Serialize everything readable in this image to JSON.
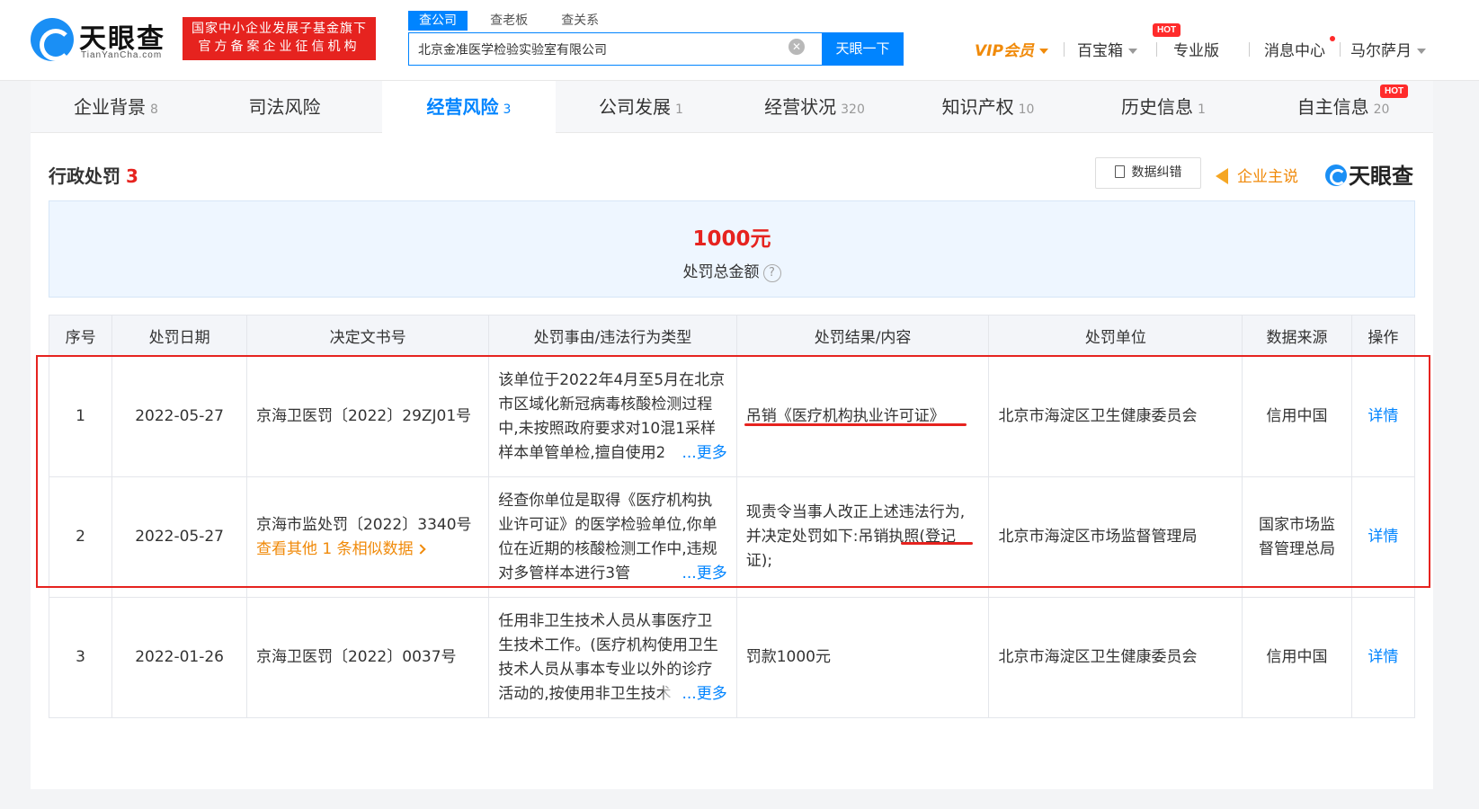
{
  "header": {
    "logo_text": "天眼查",
    "logo_sub": "TianYanCha.com",
    "badge_line1": "国家中小企业发展子基金旗下",
    "badge_line2": "官方备案企业征信机构",
    "search_tabs": [
      "查公司",
      "查老板",
      "查关系"
    ],
    "search_value": "北京金准医学检验实验室有限公司",
    "search_button": "天眼一下",
    "nav": {
      "vip": "VIP会员",
      "toolbox": "百宝箱",
      "toolbox_badge": "HOT",
      "pro": "专业版",
      "messages": "消息中心",
      "user": "马尔萨月"
    }
  },
  "categories": [
    {
      "label": "企业背景",
      "count": "8"
    },
    {
      "label": "司法风险",
      "count": ""
    },
    {
      "label": "经营风险",
      "count": "3"
    },
    {
      "label": "公司发展",
      "count": "1"
    },
    {
      "label": "经营状况",
      "count": "320"
    },
    {
      "label": "知识产权",
      "count": "10"
    },
    {
      "label": "历史信息",
      "count": "1"
    },
    {
      "label": "自主信息",
      "count": "20",
      "badge": "HOT"
    }
  ],
  "section": {
    "title": "行政处罚",
    "count": "3",
    "fix_button": "数据纠错",
    "claim": "企业主说",
    "brand": "天眼查"
  },
  "summary": {
    "amount": "1000元",
    "label": "处罚总金额",
    "help_icon": "question-circle-icon"
  },
  "table": {
    "headers": [
      "序号",
      "处罚日期",
      "决定文书号",
      "处罚事由/违法行为类型",
      "处罚结果/内容",
      "处罚单位",
      "数据来源",
      "操作"
    ],
    "more_label": "...更多",
    "rows": [
      {
        "no": "1",
        "date": "2022-05-27",
        "doc": "京海卫医罚〔2022〕29ZJ01号",
        "doc_extra": "",
        "reason": "该单位于2022年4月至5月在北京市区域化新冠病毒核酸检测过程中,未按照政府要求对10混1采样样本单管单检,擅自使用2",
        "result": "吊销《医疗机构执业许可证》",
        "authority": "北京市海淀区卫生健康委员会",
        "source": "信用中国",
        "action": "详情"
      },
      {
        "no": "2",
        "date": "2022-05-27",
        "doc": "京海市监处罚〔2022〕3340号",
        "doc_extra": "查看其他 1 条相似数据",
        "reason": "经查你单位是取得《医疗机构执业许可证》的医学检验单位,你单位在近期的核酸检测工作中,违规对多管样本进行3管",
        "result": "现责令当事人改正上述违法行为,并决定处罚如下:吊销执照(登记证);",
        "authority": "北京市海淀区市场监督管理局",
        "source": "国家市场监督管理总局",
        "action": "详情"
      },
      {
        "no": "3",
        "date": "2022-01-26",
        "doc": "京海卫医罚〔2022〕0037号",
        "doc_extra": "",
        "reason": "任用非卫生技术人员从事医疗卫生技术工作。(医疗机构使用卫生技术人员从事本专业以外的诊疗活动的,按使用非卫生技术",
        "result": "罚款1000元",
        "authority": "北京市海淀区卫生健康委员会",
        "source": "信用中国",
        "action": "详情"
      }
    ]
  },
  "colors": {
    "accent": "#0084ff",
    "alert": "#e6231f",
    "vip": "#f08a0a"
  }
}
